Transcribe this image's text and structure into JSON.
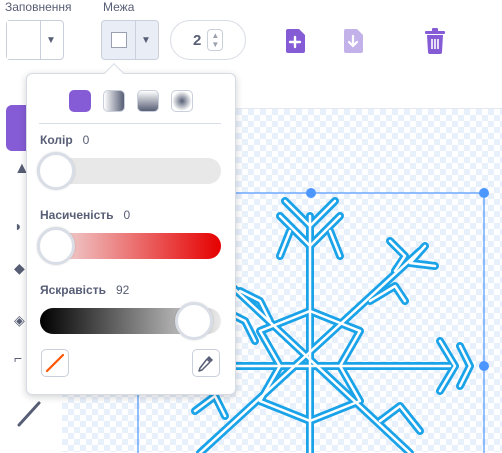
{
  "toolbar": {
    "fill_label": "Заповнення",
    "outline_label": "Межа",
    "outline_width": "2",
    "stepper_up": "▲",
    "stepper_down": "▼",
    "dropdown_arrow": "▼"
  },
  "picker": {
    "hue_label": "Колір",
    "hue_value": "0",
    "saturation_label": "Насиченість",
    "saturation_value": "0",
    "brightness_label": "Яскравість",
    "brightness_value": "92",
    "hue_fraction": 0,
    "saturation_fraction": 0,
    "brightness_fraction": 0.92,
    "gradient_types": [
      "solid",
      "horizontal",
      "vertical",
      "radial"
    ],
    "selected_gradient": "solid"
  },
  "icons": {
    "add_costume": "add-costume-icon",
    "import": "import-icon",
    "delete": "trash-icon",
    "no_color": "no-color-icon",
    "eyedropper": "eyedropper-icon"
  },
  "colors": {
    "accent": "#855cd6",
    "shape_stroke": "#1aa3e8",
    "selection": "#4c97ff",
    "saturation_end": "#e60000",
    "no_color_line": "#ff5500"
  }
}
